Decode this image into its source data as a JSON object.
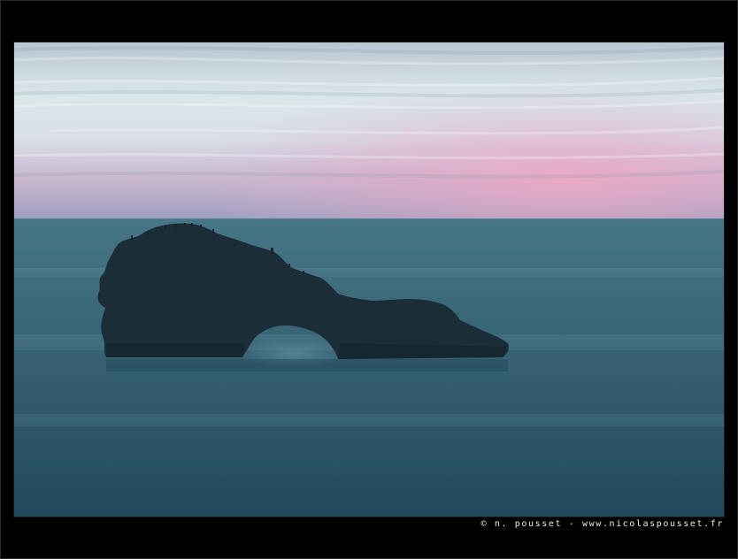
{
  "photo": {
    "subject": "sea-arch-rock",
    "colors": {
      "frame": "#000000",
      "sky_top": "#c9d6de",
      "sky_mid": "#dfe8ec",
      "sky_pink": "#e6a9c4",
      "sea_top": "#3f6f80",
      "sea_bottom": "#21485a",
      "rock": "#1a2c36"
    }
  },
  "credit": {
    "text": "© n. pousset - www.nicolaspousset.fr"
  }
}
